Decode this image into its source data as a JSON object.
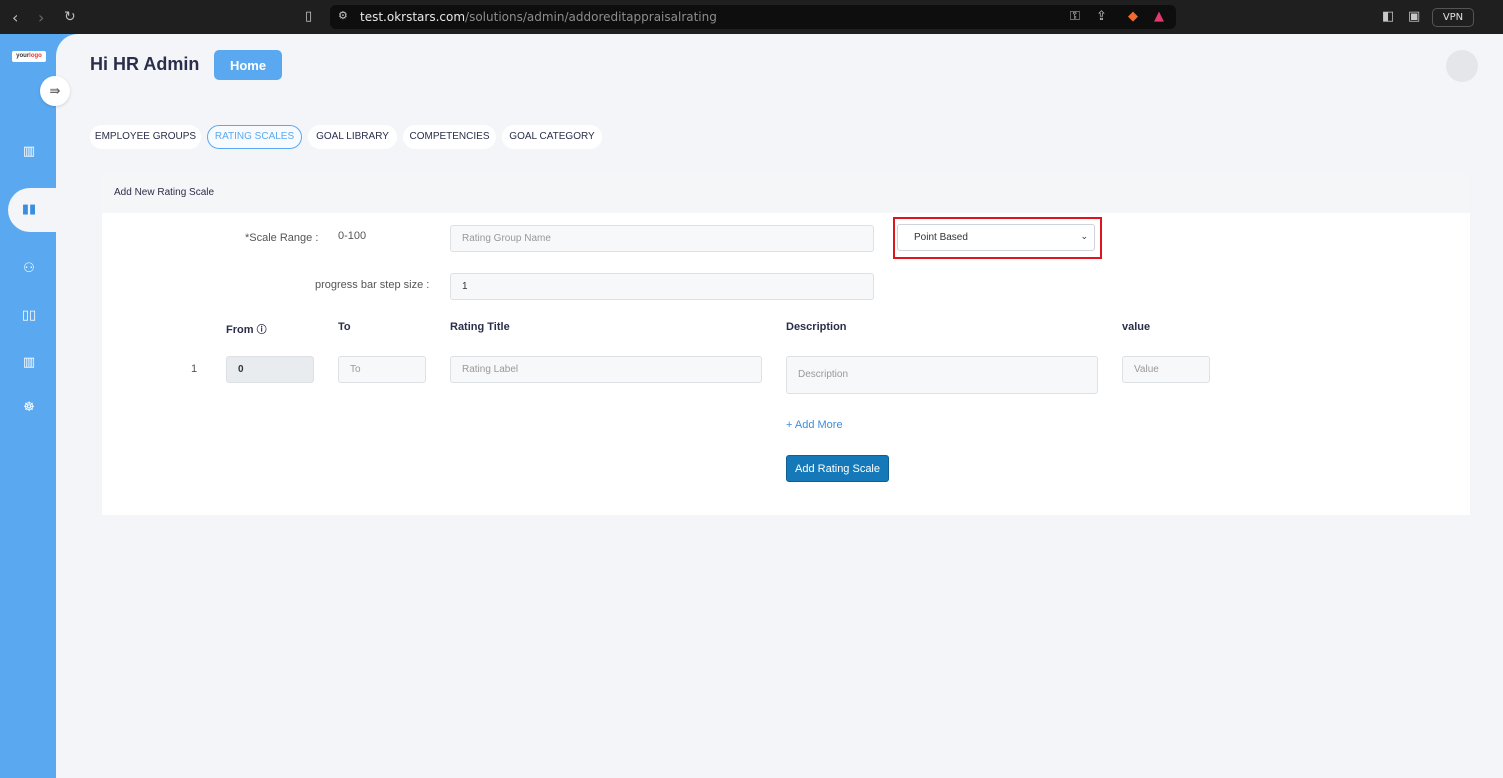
{
  "browser": {
    "url_host": "test.okrstars.com",
    "url_path": "/solutions/admin/addoreditappraisalrating",
    "vpn_label": "VPN"
  },
  "sidebar": {
    "logo_text": "your",
    "logo_text_accent": "logo",
    "toggle_icon": "⇛",
    "items": [
      {
        "name": "dashboard-icon",
        "glyph": "▥"
      },
      {
        "name": "cards-icon",
        "glyph": "▮▮"
      },
      {
        "name": "users-icon",
        "glyph": "👥"
      },
      {
        "name": "book-icon",
        "glyph": "▯▯"
      },
      {
        "name": "chart-icon",
        "glyph": "▥"
      },
      {
        "name": "hand-coin-icon",
        "glyph": "⛓"
      }
    ]
  },
  "header": {
    "greeting": "Hi HR Admin",
    "home_label": "Home"
  },
  "tabs": [
    {
      "label": "EMPLOYEE GROUPS"
    },
    {
      "label": "RATING SCALES"
    },
    {
      "label": "GOAL LIBRARY"
    },
    {
      "label": "COMPETENCIES"
    },
    {
      "label": "GOAL CATEGORY"
    }
  ],
  "form": {
    "title": "Add New Rating Scale",
    "scale_range_label": "*Scale Range :",
    "scale_range_value": "0-100",
    "group_name_placeholder": "Rating Group Name",
    "scale_type_selected": "Point Based",
    "step_size_label": "progress bar step size :",
    "step_size_value": "1",
    "columns": {
      "from": "From",
      "to": "To",
      "rating_title": "Rating Title",
      "description": "Description",
      "value": "value"
    },
    "rows": [
      {
        "index": "1",
        "from": "0",
        "to_placeholder": "To",
        "title_placeholder": "Rating Label",
        "description_placeholder": "Description",
        "value_placeholder": "Value"
      }
    ],
    "add_more_label": "+ Add More",
    "submit_label": "Add Rating Scale"
  }
}
